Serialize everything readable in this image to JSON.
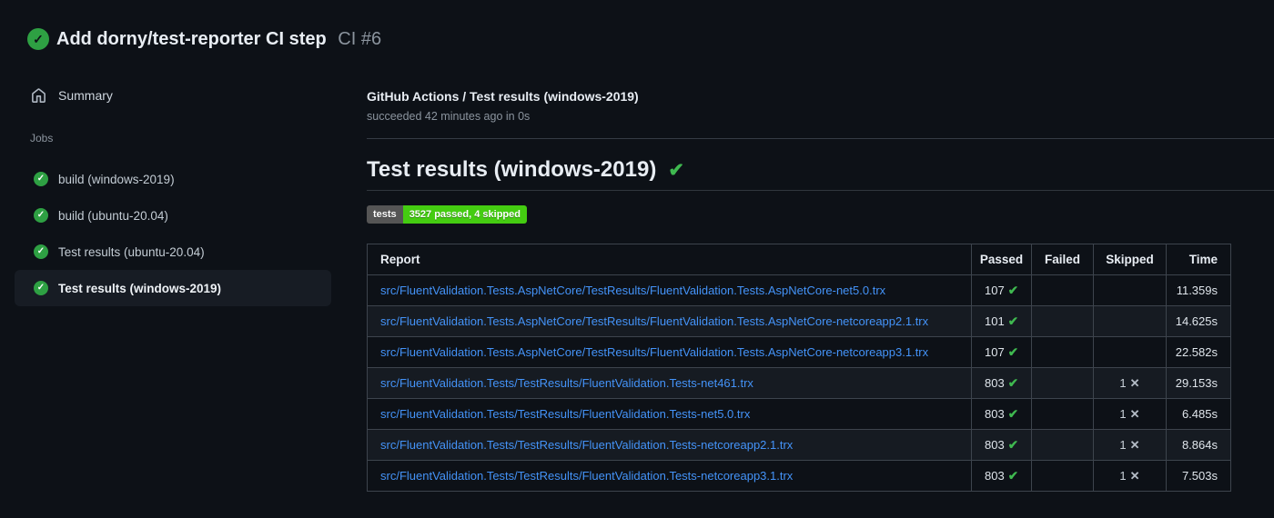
{
  "icons": {
    "check_heavy": "✔",
    "check_light": "✓",
    "cross": "✕"
  },
  "colors": {
    "page_bg": "#0d1117",
    "success_green": "#2ea043",
    "check_green": "#3fb950",
    "link_blue": "#4493f8",
    "badge_label_bg": "#555555",
    "badge_value_bg": "#44cc11",
    "table_border": "#3d444d",
    "row_alt_bg": "#161b22"
  },
  "header": {
    "title": "Add dorny/test-reporter CI step",
    "run_number": "CI #6"
  },
  "sidebar": {
    "summary_label": "Summary",
    "jobs_label": "Jobs",
    "jobs": [
      {
        "label": "build (windows-2019)"
      },
      {
        "label": "build (ubuntu-20.04)"
      },
      {
        "label": "Test results (ubuntu-20.04)"
      },
      {
        "label": "Test results (windows-2019)"
      }
    ]
  },
  "main": {
    "job_title": "GitHub Actions / Test results (windows-2019)",
    "job_status": "succeeded 42 minutes ago in 0s",
    "section_title": "Test results (windows-2019)",
    "badge": {
      "label": "tests",
      "value": "3527 passed, 4 skipped"
    },
    "table": {
      "headers": {
        "report": "Report",
        "passed": "Passed",
        "failed": "Failed",
        "skipped": "Skipped",
        "time": "Time"
      },
      "rows": [
        {
          "report": "src/FluentValidation.Tests.AspNetCore/TestResults/FluentValidation.Tests.AspNetCore-net5.0.trx",
          "passed": "107",
          "passed_icon": "✔",
          "failed": "",
          "skipped": "",
          "skipped_icon": "",
          "time": "11.359s"
        },
        {
          "report": "src/FluentValidation.Tests.AspNetCore/TestResults/FluentValidation.Tests.AspNetCore-netcoreapp2.1.trx",
          "passed": "101",
          "passed_icon": "✔",
          "failed": "",
          "skipped": "",
          "skipped_icon": "",
          "time": "14.625s"
        },
        {
          "report": "src/FluentValidation.Tests.AspNetCore/TestResults/FluentValidation.Tests.AspNetCore-netcoreapp3.1.trx",
          "passed": "107",
          "passed_icon": "✔",
          "failed": "",
          "skipped": "",
          "skipped_icon": "",
          "time": "22.582s"
        },
        {
          "report": "src/FluentValidation.Tests/TestResults/FluentValidation.Tests-net461.trx",
          "passed": "803",
          "passed_icon": "✔",
          "failed": "",
          "skipped": "1",
          "skipped_icon": "✕",
          "time": "29.153s"
        },
        {
          "report": "src/FluentValidation.Tests/TestResults/FluentValidation.Tests-net5.0.trx",
          "passed": "803",
          "passed_icon": "✔",
          "failed": "",
          "skipped": "1",
          "skipped_icon": "✕",
          "time": "6.485s"
        },
        {
          "report": "src/FluentValidation.Tests/TestResults/FluentValidation.Tests-netcoreapp2.1.trx",
          "passed": "803",
          "passed_icon": "✔",
          "failed": "",
          "skipped": "1",
          "skipped_icon": "✕",
          "time": "8.864s"
        },
        {
          "report": "src/FluentValidation.Tests/TestResults/FluentValidation.Tests-netcoreapp3.1.trx",
          "passed": "803",
          "passed_icon": "✔",
          "failed": "",
          "skipped": "1",
          "skipped_icon": "✕",
          "time": "7.503s"
        }
      ]
    }
  }
}
